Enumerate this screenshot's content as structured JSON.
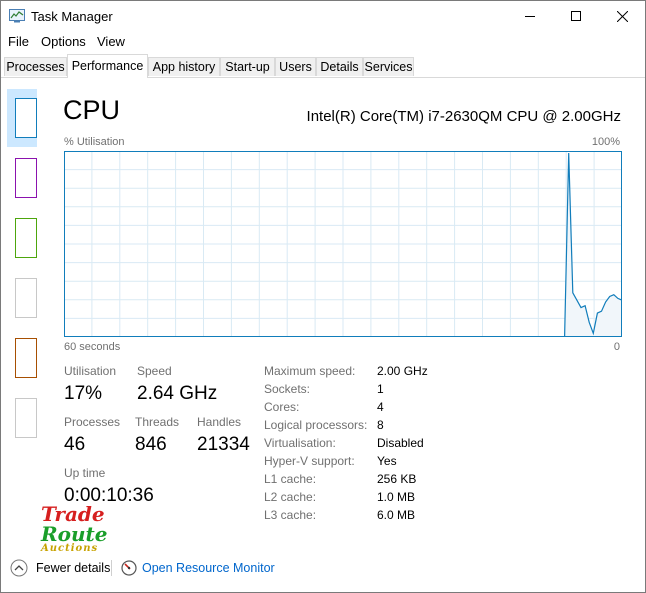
{
  "window": {
    "title": "Task Manager"
  },
  "menu": [
    "File",
    "Options",
    "View"
  ],
  "tabs": [
    {
      "label": "Processes"
    },
    {
      "label": "Performance"
    },
    {
      "label": "App history"
    },
    {
      "label": "Start-up"
    },
    {
      "label": "Users"
    },
    {
      "label": "Details"
    },
    {
      "label": "Services"
    }
  ],
  "cpu": {
    "heading": "CPU",
    "model": "Intel(R) Core(TM) i7-2630QM CPU @ 2.00GHz",
    "axis_top_left": "% Utilisation",
    "axis_top_right": "100%",
    "axis_bottom_left": "60 seconds",
    "axis_bottom_right": "0"
  },
  "stats": {
    "utilisation_label": "Utilisation",
    "utilisation_value": "17%",
    "speed_label": "Speed",
    "speed_value": "2.64 GHz",
    "processes_label": "Processes",
    "processes_value": "46",
    "threads_label": "Threads",
    "threads_value": "846",
    "handles_label": "Handles",
    "handles_value": "21334",
    "uptime_label": "Up time",
    "uptime_value": "0:00:10:36"
  },
  "info": [
    {
      "label": "Maximum speed:",
      "value": "2.00 GHz"
    },
    {
      "label": "Sockets:",
      "value": "1"
    },
    {
      "label": "Cores:",
      "value": "4"
    },
    {
      "label": "Logical processors:",
      "value": "8"
    },
    {
      "label": "Virtualisation:",
      "value": "Disabled"
    },
    {
      "label": "Hyper-V support:",
      "value": "Yes"
    },
    {
      "label": "L1 cache:",
      "value": "256 KB"
    },
    {
      "label": "L2 cache:",
      "value": "1.0 MB"
    },
    {
      "label": "L3 cache:",
      "value": "6.0 MB"
    }
  ],
  "watermark": {
    "line1": "Trade",
    "line2": "Route",
    "line3": "Auctions"
  },
  "footer": {
    "fewer_details": "Fewer details",
    "resource_monitor": "Open Resource Monitor"
  },
  "graph_series": [
    0,
    0,
    0,
    0,
    0,
    0,
    0,
    0,
    0,
    0,
    0,
    0,
    0,
    0,
    0,
    0,
    0,
    0,
    0,
    0,
    0,
    0,
    0,
    0,
    0,
    0,
    0,
    0,
    0,
    0,
    0,
    0,
    0,
    0,
    0,
    0,
    0,
    0,
    0,
    0,
    0,
    0,
    0,
    0,
    0,
    0,
    0,
    0,
    0,
    0,
    0,
    0,
    0,
    0,
    0,
    0,
    0,
    0,
    0,
    0,
    0,
    0,
    0,
    0,
    0,
    0,
    0,
    0,
    0,
    0,
    0,
    0,
    0,
    0,
    0,
    0,
    0,
    0,
    0,
    0,
    0,
    0,
    0,
    0,
    0,
    0,
    0,
    0,
    0,
    0,
    0,
    0,
    0,
    0,
    0,
    0,
    0,
    0,
    0,
    0,
    0,
    0,
    0,
    0,
    0,
    0,
    0,
    0,
    0,
    0,
    0,
    0,
    0,
    0,
    0,
    0,
    0,
    0,
    0,
    0,
    0,
    0,
    0,
    100,
    24,
    20,
    16,
    17,
    8,
    2,
    13,
    14,
    19,
    22,
    23,
    21,
    20
  ]
}
